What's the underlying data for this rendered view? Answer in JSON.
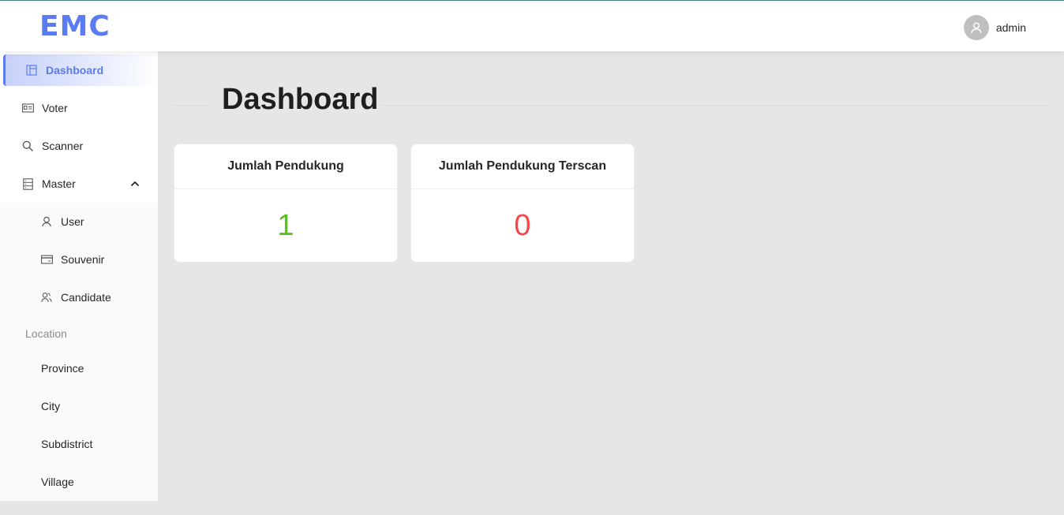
{
  "app": {
    "logo": "EMC"
  },
  "header": {
    "username": "admin"
  },
  "sidebar": {
    "items": [
      {
        "label": "Dashboard",
        "icon": "dashboard-icon",
        "active": true
      },
      {
        "label": "Voter",
        "icon": "id-card-icon"
      },
      {
        "label": "Scanner",
        "icon": "search-icon"
      },
      {
        "label": "Master",
        "icon": "database-icon",
        "expanded": true
      }
    ],
    "master_children": [
      {
        "label": "User",
        "icon": "user-icon"
      },
      {
        "label": "Souvenir",
        "icon": "credit-card-icon"
      },
      {
        "label": "Candidate",
        "icon": "team-icon"
      }
    ],
    "location_group": {
      "title": "Location",
      "items": [
        "Province",
        "City",
        "Subdistrict",
        "Village"
      ]
    }
  },
  "page": {
    "title": "Dashboard"
  },
  "cards": [
    {
      "title": "Jumlah Pendukung",
      "value": "1",
      "color": "#52c41a"
    },
    {
      "title": "Jumlah Pendukung Terscan",
      "value": "0",
      "color": "#f5484a"
    }
  ],
  "colors": {
    "accent": "#5b7cf0",
    "background": "#e6e6e6"
  }
}
